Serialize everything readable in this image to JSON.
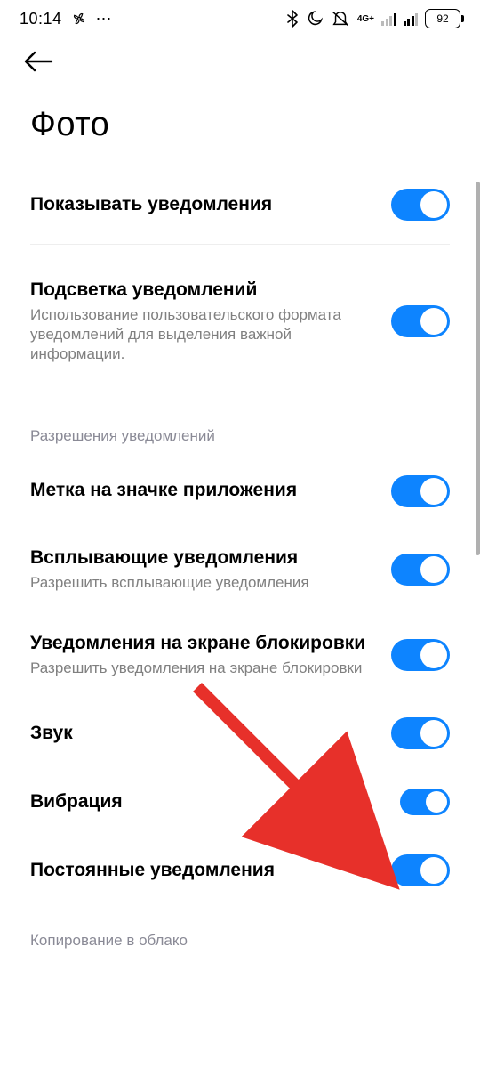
{
  "status": {
    "time": "10:14",
    "network_label": "4G+",
    "battery": "92"
  },
  "page_title": "Фото",
  "rows": {
    "show_notifications": {
      "label": "Показывать уведомления"
    },
    "highlight": {
      "label": "Подсветка уведомлений",
      "sub": "Использование пользовательского формата уведомлений для выделения важной информации."
    }
  },
  "section_header": "Разрешения уведомлений",
  "perm": {
    "badge": {
      "label": "Метка на значке приложения"
    },
    "popup": {
      "label": "Всплывающие уведомления",
      "sub": "Разрешить всплывающие уведомления"
    },
    "lockscreen": {
      "label": "Уведомления на экране блокировки",
      "sub": "Разрешить уведомления на экране блокировки"
    },
    "sound": {
      "label": "Звук"
    },
    "vibration": {
      "label": "Вибрация"
    },
    "persistent": {
      "label": "Постоянные уведомления"
    }
  },
  "footer_section": "Копирование в облако"
}
